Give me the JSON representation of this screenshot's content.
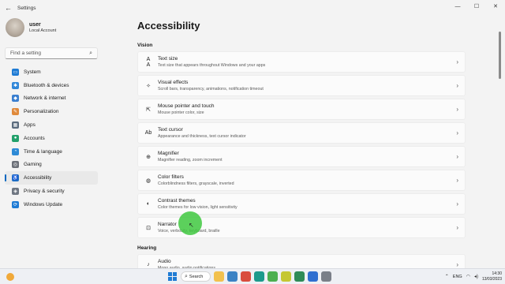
{
  "window": {
    "title": "Settings",
    "back": "←",
    "controls": [
      "—",
      "☐",
      "✕"
    ]
  },
  "user": {
    "name": "user",
    "account": "Local Account"
  },
  "search": {
    "placeholder": "Find a setting",
    "icon": "search-icon"
  },
  "nav": [
    {
      "label": "System",
      "icon": "monitor-icon",
      "color": "#1f7bd4",
      "glyph": "▭",
      "active": false
    },
    {
      "label": "Bluetooth & devices",
      "icon": "bluetooth-icon",
      "color": "#2f86d8",
      "glyph": "✱",
      "active": false
    },
    {
      "label": "Network & internet",
      "icon": "wifi-icon",
      "color": "#3a7fd0",
      "glyph": "◆",
      "active": false
    },
    {
      "label": "Personalization",
      "icon": "brush-icon",
      "color": "#e08a3c",
      "glyph": "✎",
      "active": false
    },
    {
      "label": "Apps",
      "icon": "apps-icon",
      "color": "#5a6b7d",
      "glyph": "▦",
      "active": false
    },
    {
      "label": "Accounts",
      "icon": "person-icon",
      "color": "#22a06b",
      "glyph": "●",
      "active": false
    },
    {
      "label": "Time & language",
      "icon": "clock-globe-icon",
      "color": "#2d8ad6",
      "glyph": "◔",
      "active": false
    },
    {
      "label": "Gaming",
      "icon": "controller-icon",
      "color": "#6b6f77",
      "glyph": "◎",
      "active": false
    },
    {
      "label": "Accessibility",
      "icon": "accessibility-icon",
      "color": "#1d6fc7",
      "glyph": "♿",
      "active": true
    },
    {
      "label": "Privacy & security",
      "icon": "shield-icon",
      "color": "#6e7681",
      "glyph": "◈",
      "active": false
    },
    {
      "label": "Windows Update",
      "icon": "update-icon",
      "color": "#1f7bd4",
      "glyph": "⟳",
      "active": false
    }
  ],
  "page": {
    "title": "Accessibility"
  },
  "sections": [
    {
      "title": "Vision",
      "items": [
        {
          "title": "Text size",
          "desc": "Text size that appears throughout Windows and your apps",
          "glyph": "A A"
        },
        {
          "title": "Visual effects",
          "desc": "Scroll bars, transparency, animations, notification timeout",
          "glyph": "✧"
        },
        {
          "title": "Mouse pointer and touch",
          "desc": "Mouse pointer color, size",
          "glyph": "⇱"
        },
        {
          "title": "Text cursor",
          "desc": "Appearance and thickness, text cursor indicator",
          "glyph": "Ab"
        },
        {
          "title": "Magnifier",
          "desc": "Magnifier reading, zoom increment",
          "glyph": "⊕"
        },
        {
          "title": "Color filters",
          "desc": "Colorblindness filters, grayscale, inverted",
          "glyph": "◍"
        },
        {
          "title": "Contrast themes",
          "desc": "Color themes for low vision, light sensitivity",
          "glyph": "◐"
        },
        {
          "title": "Narrator",
          "desc": "Voice, verbosity, keyboard, braille",
          "glyph": "⊡"
        }
      ]
    },
    {
      "title": "Hearing",
      "items": [
        {
          "title": "Audio",
          "desc": "Mono audio, audio notifications",
          "glyph": "♪"
        }
      ]
    }
  ],
  "chevron": "›",
  "taskbar": {
    "search_label": "Search",
    "search_icon": "⌕",
    "apps": [
      {
        "name": "file-explorer-icon",
        "color": "#f2c14e"
      },
      {
        "name": "photos-icon",
        "color": "#3b82c4"
      },
      {
        "name": "chrome-icon",
        "color": "#d94c3d"
      },
      {
        "name": "edge-icon",
        "color": "#1c9a8c"
      },
      {
        "name": "app-green-icon",
        "color": "#4caf50"
      },
      {
        "name": "app-yellow-icon",
        "color": "#c5c733"
      },
      {
        "name": "app-green2-icon",
        "color": "#2e8b57"
      },
      {
        "name": "app-blue-icon",
        "color": "#2f6fd0"
      },
      {
        "name": "settings-gear-icon",
        "color": "#7a7f88"
      }
    ],
    "lang": "ENG",
    "time": "14:30",
    "date": "13/03/2023"
  },
  "accent": "#0067c0"
}
